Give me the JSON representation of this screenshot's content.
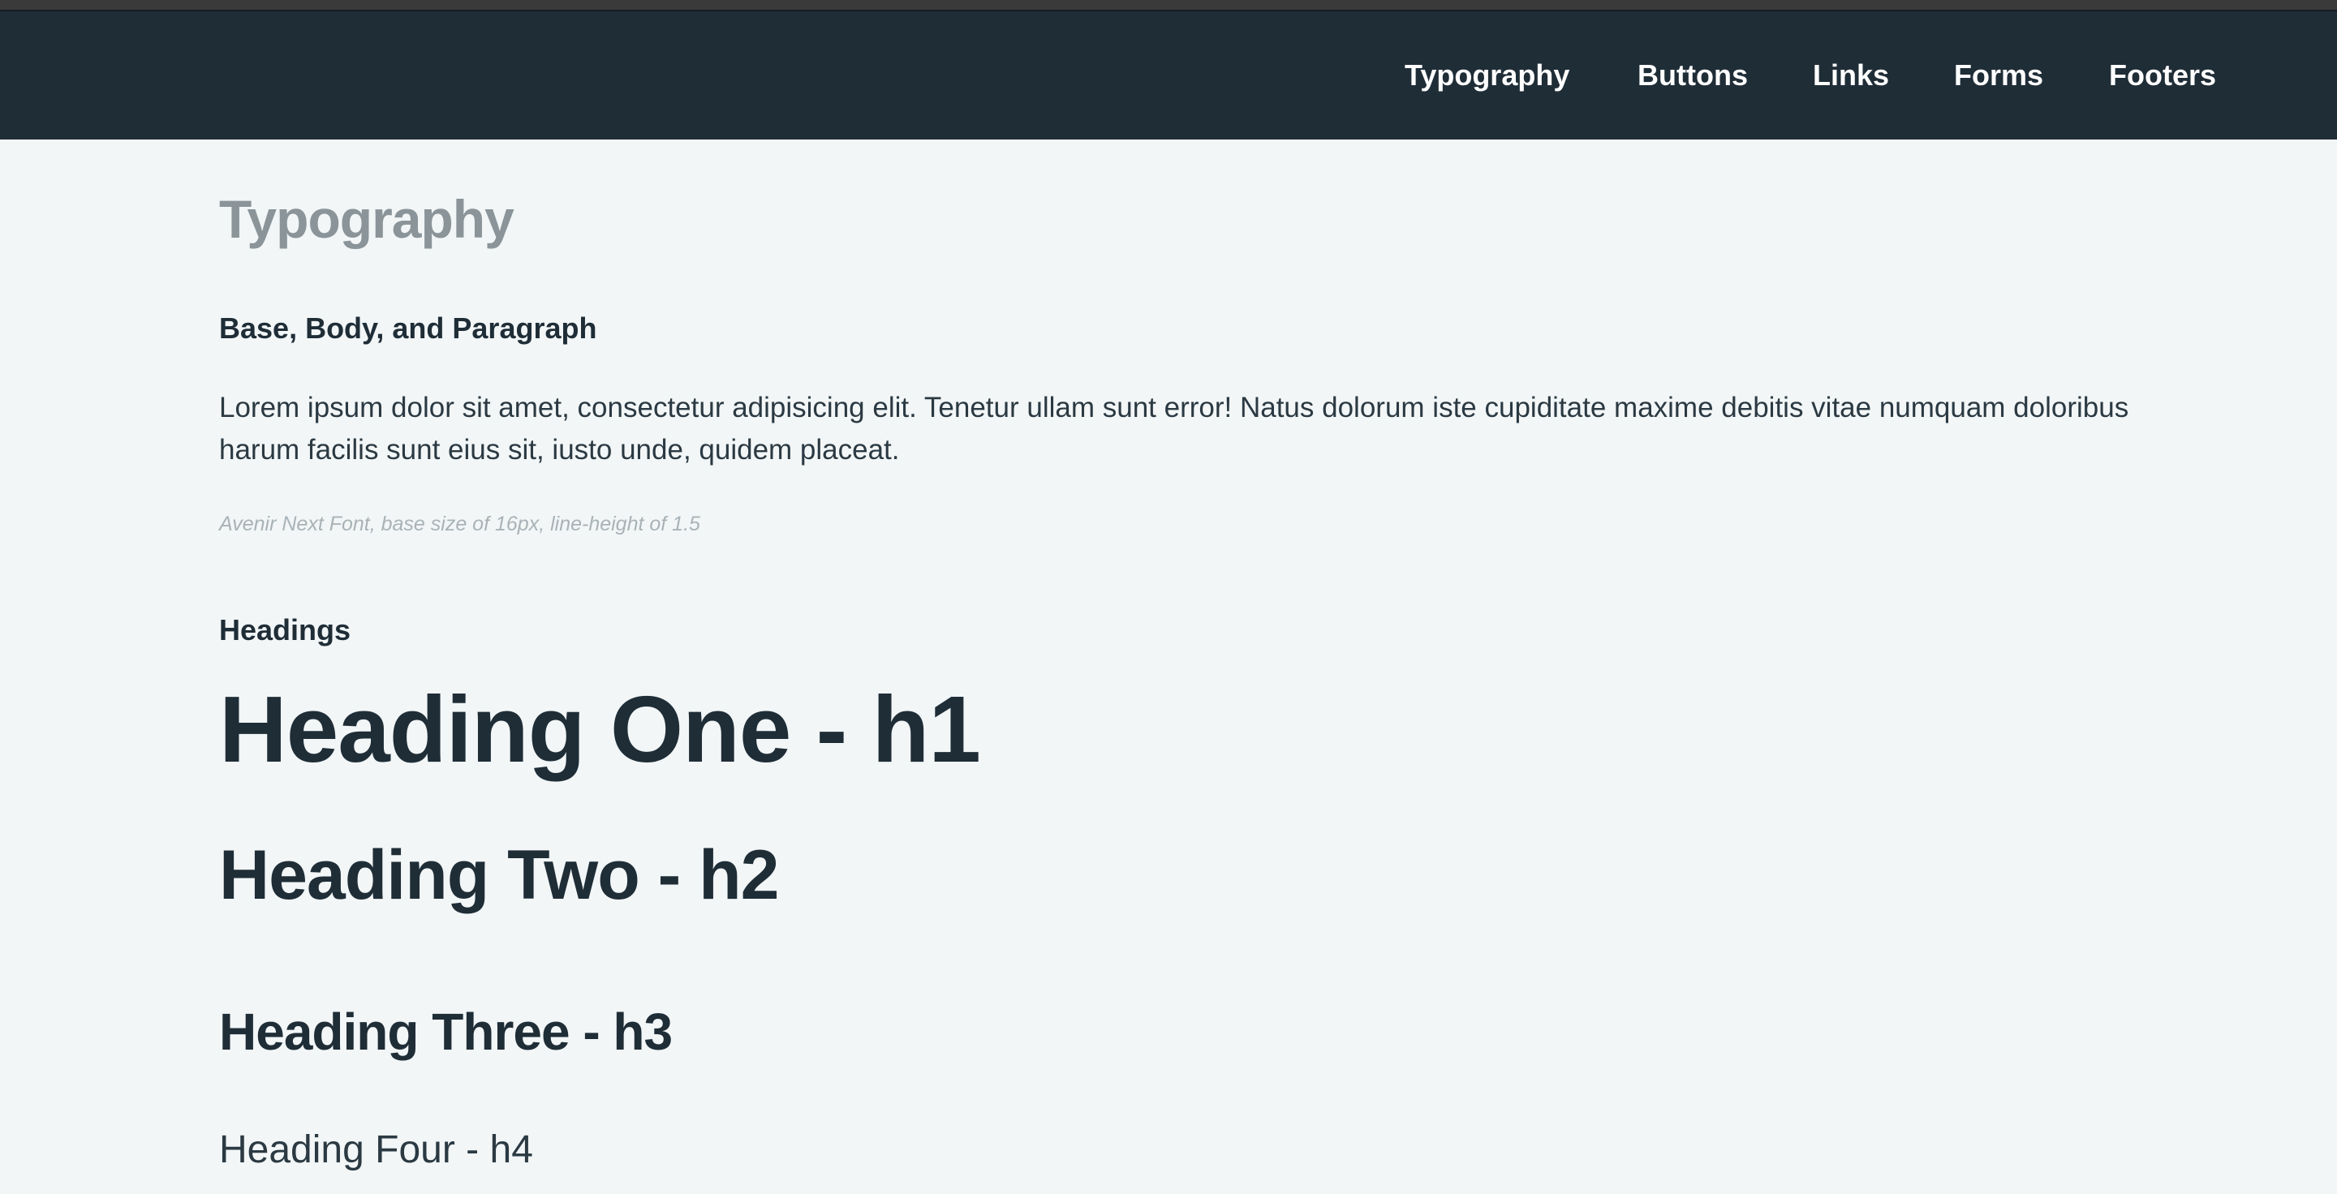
{
  "nav": {
    "items": [
      {
        "label": "Typography"
      },
      {
        "label": "Buttons"
      },
      {
        "label": "Links"
      },
      {
        "label": "Forms"
      },
      {
        "label": "Footers"
      }
    ]
  },
  "page": {
    "title": "Typography",
    "base_section": {
      "label": "Base, Body, and Paragraph",
      "paragraph": "Lorem ipsum dolor sit amet, consectetur adipisicing elit. Tenetur ullam sunt error! Natus dolorum iste cupiditate maxime debitis vitae numquam doloribus harum facilis sunt eius sit, iusto unde, quidem placeat.",
      "note": "Avenir Next Font, base size of 16px, line-height of 1.5"
    },
    "headings_section": {
      "label": "Headings",
      "h1": "Heading One - h1",
      "h2": "Heading Two - h2",
      "h3": "Heading Three - h3",
      "h4": "Heading Four - h4"
    }
  },
  "colors": {
    "navbar": "#1f2d37",
    "background": "#f2f6f7",
    "title_gray": "#8a9499",
    "note_gray": "#a9b3b7"
  }
}
